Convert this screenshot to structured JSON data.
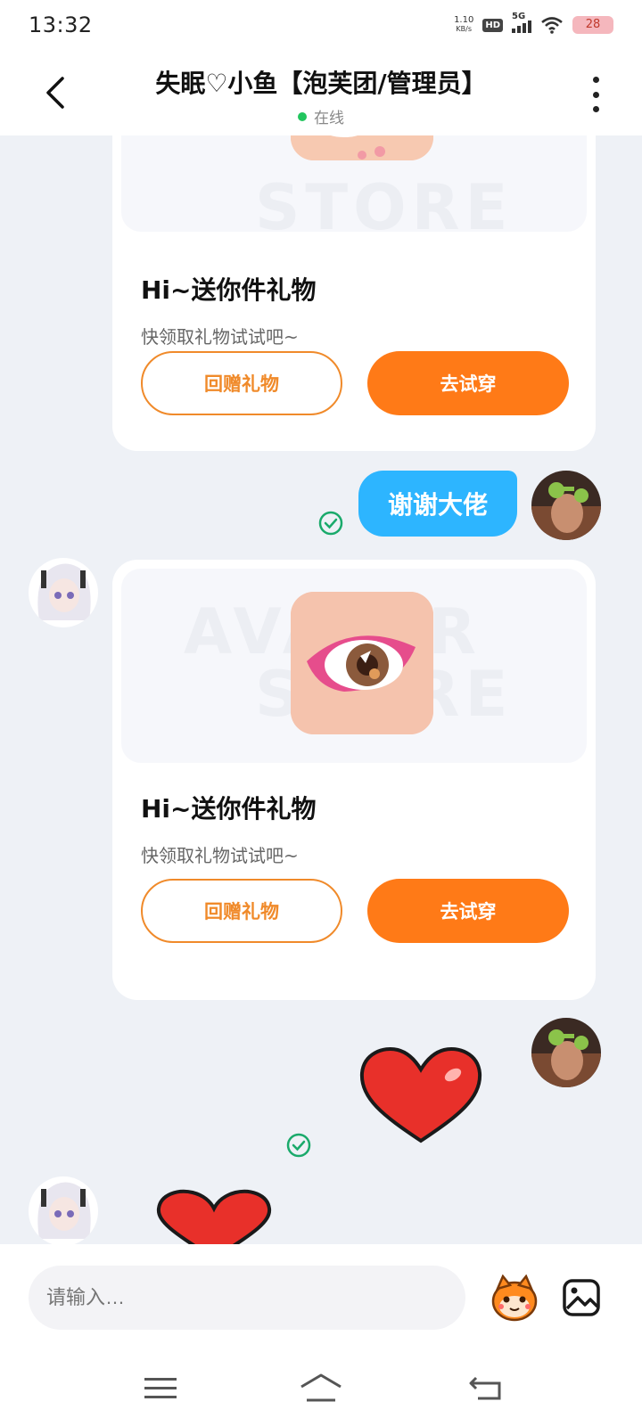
{
  "status_bar": {
    "time": "13:32",
    "net_speed_value": "1.10",
    "net_speed_unit": "KB/s",
    "hd_badge": "HD",
    "network": "5G",
    "battery": "28"
  },
  "header": {
    "title": "失眠♡小鱼【泡芙团/管理员】",
    "status": "在线"
  },
  "messages": [
    {
      "type": "gift_card",
      "title": "Hi~送你件礼物",
      "subtitle": "快领取礼物试试吧~",
      "return_gift_label": "回赠礼物",
      "try_on_label": "去试穿"
    },
    {
      "type": "text",
      "text": "谢谢大佬"
    },
    {
      "type": "gift_card",
      "title": "Hi~送你件礼物",
      "subtitle": "快领取礼物试试吧~",
      "return_gift_label": "回赠礼物",
      "try_on_label": "去试穿"
    }
  ],
  "watermark": {
    "line1": "AVATAR",
    "line2": "STORE"
  },
  "input_bar": {
    "placeholder": "请输入…"
  },
  "colors": {
    "accent_orange": "#ff7a17",
    "bubble_blue": "#2db5ff",
    "online_green": "#22c55e",
    "read_check_green": "#1aaa6b"
  }
}
